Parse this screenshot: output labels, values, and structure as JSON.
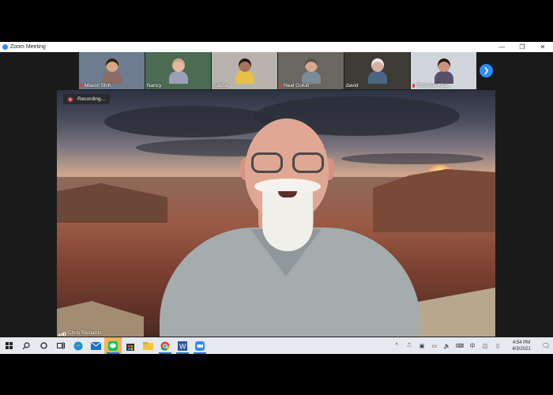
{
  "window": {
    "title": "Zoom Meeting",
    "controls": {
      "minimize": "—",
      "maximize": "❐",
      "close": "✕"
    }
  },
  "participants": [
    {
      "name": "Miaoxi Shih",
      "muted": true,
      "bg": "#6d7c8e",
      "skin": "#d9a77f",
      "hair": "#2b1e1a",
      "shirt": "#8a6c63"
    },
    {
      "name": "Nancy",
      "muted": false,
      "bg": "#4b6b52",
      "skin": "#e5b89d",
      "hair": "#caa88b",
      "shirt": "#9aa1b7"
    },
    {
      "name": "Sacha",
      "muted": false,
      "bg": "#b9b3ad",
      "skin": "#a8735c",
      "hair": "#231a17",
      "shirt": "#e8c043"
    },
    {
      "name": "Neal Golub",
      "muted": true,
      "bg": "#6a6660",
      "skin": "#d6a98f",
      "hair": "#5a5049",
      "shirt": "#7a8a96"
    },
    {
      "name": "david",
      "muted": false,
      "bg": "#3e3b36",
      "skin": "#d9b0a1",
      "hair": "#ececec",
      "shirt": "#4b6784"
    },
    {
      "name": "Christine Kha...",
      "muted": true,
      "bg": "#cfd5da",
      "skin": "#c99479",
      "hair": "#241a17",
      "shirt": "#5a4f6a"
    }
  ],
  "next_icon": "chevron-right-icon",
  "main": {
    "recording_label": "Recording...",
    "speaker": "Chris Richards"
  },
  "taskbar": {
    "apps": [
      "windows-start-icon",
      "search-icon",
      "cortana-icon",
      "task-view-icon",
      "edge-icon",
      "mail-icon",
      "line-icon",
      "store-icon",
      "file-explorer-icon",
      "chrome-icon",
      "word-icon",
      "zoom-icon"
    ],
    "time": "4:54 PM",
    "date": "4/3/2021"
  }
}
